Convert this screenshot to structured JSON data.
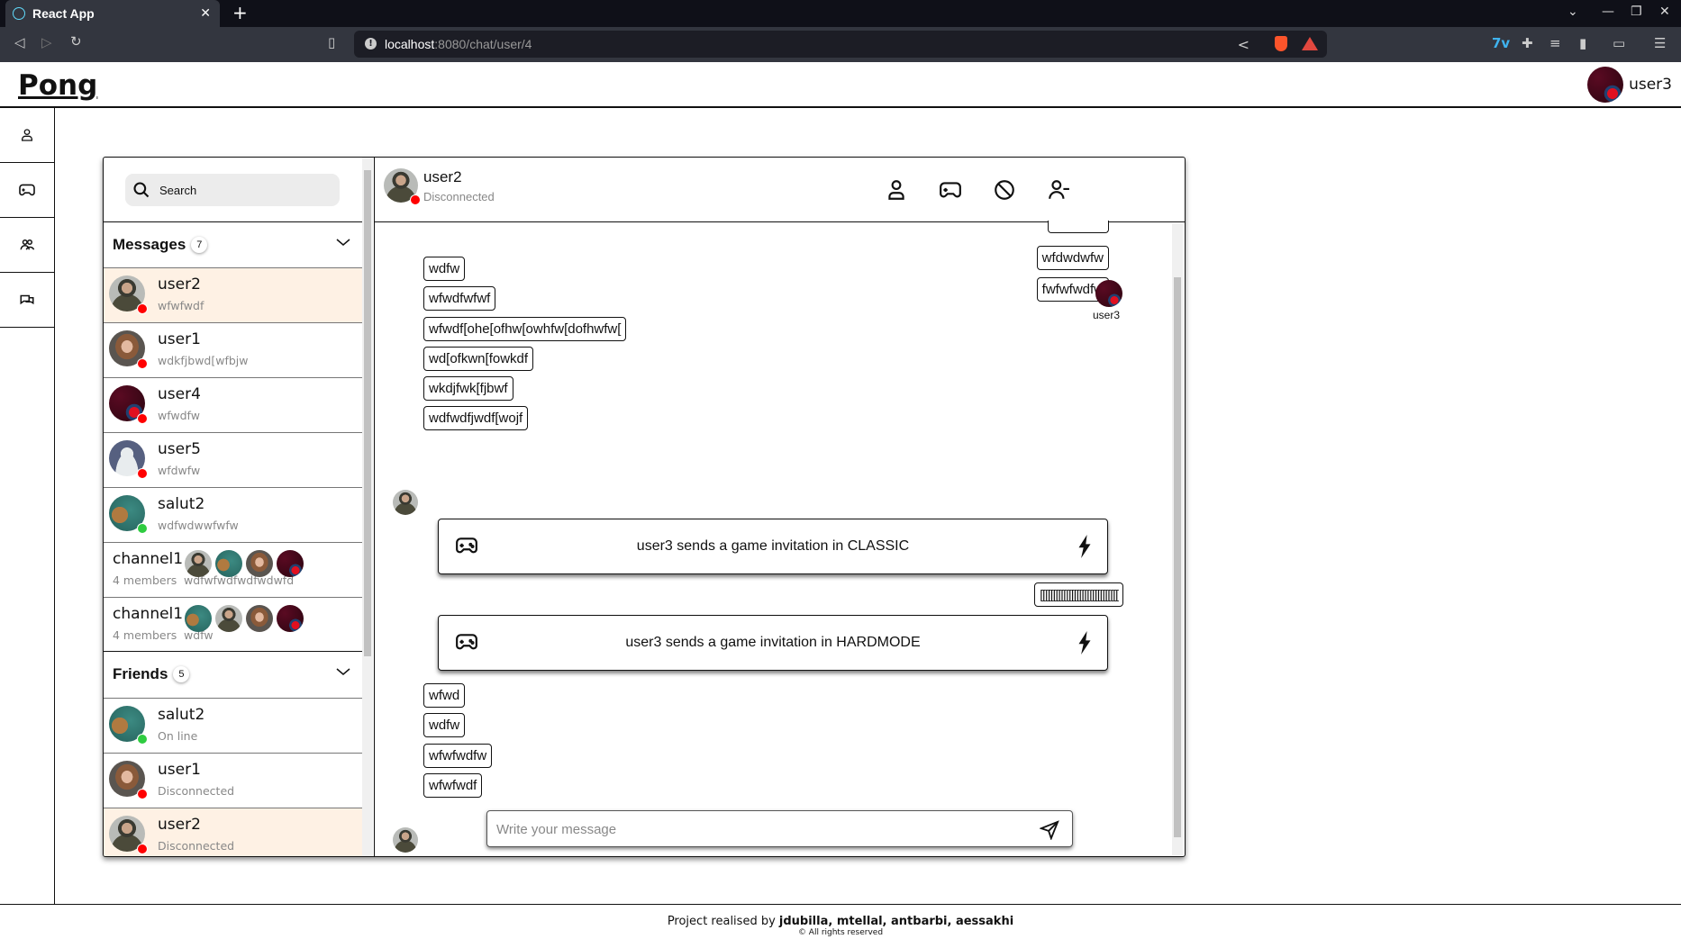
{
  "browser": {
    "tab_title": "React App",
    "url_host": "localhost",
    "url_path": ":8080/chat/user/4"
  },
  "header": {
    "logo": "Pong",
    "current_user": "user3"
  },
  "sidenav": [
    "profile-icon",
    "gamepad-icon",
    "users-icon",
    "chat-icon"
  ],
  "colors": {
    "online": "#2ecc40",
    "offline": "#ff0000",
    "active_row": "#fef1e4"
  },
  "search": {
    "placeholder": "Search"
  },
  "messages_section": {
    "title": "Messages",
    "count": "7",
    "items": [
      {
        "name": "user2",
        "preview": "wfwfwdf",
        "status": "offline",
        "active": true
      },
      {
        "name": "user1",
        "preview": "wdkfjbwd[wfbjw",
        "status": "offline"
      },
      {
        "name": "user4",
        "preview": "wfwdfw",
        "status": "offline"
      },
      {
        "name": "user5",
        "preview": "wfdwfw",
        "status": "offline"
      },
      {
        "name": "salut2",
        "preview": "wdfwdwwfwfw",
        "status": "online"
      }
    ],
    "channels": [
      {
        "name": "channel1",
        "members": "4 members",
        "preview": "wdfwfwdfwdfwdwfd",
        "member_avatars": [
          "user2",
          "salut2",
          "user1",
          "user4"
        ]
      },
      {
        "name": "channel1",
        "members": "4 members",
        "preview": "wdfw",
        "member_avatars": [
          "salut2",
          "user2",
          "user1",
          "user4"
        ]
      }
    ]
  },
  "friends_section": {
    "title": "Friends",
    "count": "5",
    "items": [
      {
        "name": "salut2",
        "status_text": "On line",
        "status": "online"
      },
      {
        "name": "user1",
        "status_text": "Disconnected",
        "status": "offline"
      },
      {
        "name": "user2",
        "status_text": "Disconnected",
        "status": "offline",
        "active": true
      }
    ]
  },
  "chat": {
    "contact": {
      "name": "user2",
      "status_text": "Disconnected",
      "status": "offline"
    },
    "actions": [
      "profile-icon",
      "invite-game-icon",
      "block-icon",
      "remove-friend-icon"
    ],
    "messages_top_right": [
      "wfdwdwfw",
      "fwfwfwdfw"
    ],
    "sender_label": "user3",
    "messages_left_1": [
      "wdfw",
      "wfwdfwfwf",
      "wfwdf[ohe[ofhw[owhfw[dofhwfw[",
      "wd[ofkwn[fowkdf",
      "wkdjfwk[fjbwf",
      "wdfwdfjwdf[wojf"
    ],
    "invitation_classic": "user3 sends a game invitation in CLASSIC",
    "bracket_message": "[[[[[[[[[[[[[[[[[[[[[[[[[[[[[[",
    "invitation_hardmode": "user3 sends a game invitation in HARDMODE",
    "messages_left_2": [
      "wfwd",
      "wdfw",
      "wfwfwdfw",
      "wfwfwdf"
    ],
    "input_placeholder": "Write your message"
  },
  "footer": {
    "prefix": "Project realised by ",
    "authors": "jdubilla, mtellal, antbarbi, aessakhi",
    "rights": "© All rights reserved"
  }
}
